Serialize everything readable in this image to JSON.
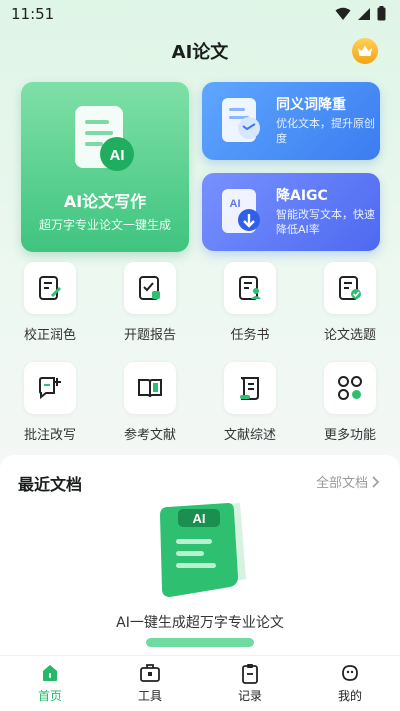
{
  "status_bar": {
    "time": "11:51",
    "icons": [
      "wifi-icon",
      "signal-icon",
      "battery-icon"
    ]
  },
  "header": {
    "title": "AI论文",
    "vip_icon": "crown-icon"
  },
  "hero": {
    "title": "AI论文写作",
    "subtitle": "超万字专业论文一键生成",
    "icon_text": "AI"
  },
  "side_cards": [
    {
      "title": "同义词降重",
      "subtitle": "优化文本，提升原创度"
    },
    {
      "title": "降AIGC",
      "subtitle": "智能改写文本，快速降低AI率",
      "icon_text": "AI"
    }
  ],
  "tools": [
    {
      "label": "校正润色",
      "icon": "edit-doc-icon"
    },
    {
      "label": "开题报告",
      "icon": "report-icon"
    },
    {
      "label": "任务书",
      "icon": "task-doc-icon"
    },
    {
      "label": "论文选题",
      "icon": "topic-check-icon"
    },
    {
      "label": "批注改写",
      "icon": "comment-add-icon"
    },
    {
      "label": "参考文献",
      "icon": "book-icon"
    },
    {
      "label": "文献综述",
      "icon": "scroll-icon"
    },
    {
      "label": "更多功能",
      "icon": "grid-icon"
    }
  ],
  "recent": {
    "title": "最近文档",
    "all_link": "全部文档",
    "illustration_text": "AI",
    "empty_text": "AI一键生成超万字专业论文"
  },
  "nav": [
    {
      "label": "首页",
      "icon": "home-icon",
      "active": true
    },
    {
      "label": "工具",
      "icon": "toolbox-icon",
      "active": false
    },
    {
      "label": "记录",
      "icon": "clipboard-icon",
      "active": false
    },
    {
      "label": "我的",
      "icon": "profile-icon",
      "active": false
    }
  ],
  "colors": {
    "accent_green": "#3fc47f",
    "accent_blue": "#3b7cf0",
    "vip_gold": "#f3a316"
  }
}
